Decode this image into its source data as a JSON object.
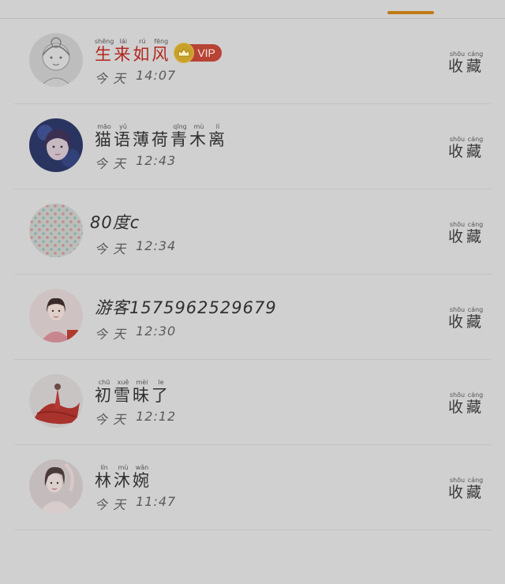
{
  "users": [
    {
      "name_chars": [
        "生",
        "来",
        "如",
        "风"
      ],
      "name_pinyin": [
        "shēng",
        "lái",
        "rú",
        "fēng"
      ],
      "day": "今 天",
      "time": "14:07",
      "vip": true,
      "vip_label": "VIP",
      "avatar": "sketch-girl-avatar"
    },
    {
      "name_chars": [
        "猫",
        "语",
        "薄",
        "荷",
        "青",
        "木",
        "离"
      ],
      "name_pinyin": [
        "māo",
        "yǔ",
        "",
        "",
        "qīng",
        "mù",
        "lí"
      ],
      "day": "今 天",
      "time": "12:43",
      "vip": false,
      "avatar": "blue-haired-girl-avatar"
    },
    {
      "name_text": "80度c",
      "day": "今 天",
      "time": "12:34",
      "vip": false,
      "avatar": "polka-dot-pattern-avatar"
    },
    {
      "name_text": "游客1575962529679",
      "day": "今 天",
      "time": "12:30",
      "vip": false,
      "avatar": "pink-dress-girl-avatar"
    },
    {
      "name_chars": [
        "初",
        "雪",
        "昧",
        "了"
      ],
      "name_pinyin": [
        "chū",
        "xuě",
        "mèi",
        "le"
      ],
      "day": "今 天",
      "time": "12:12",
      "vip": false,
      "avatar": "red-gown-figure-avatar"
    },
    {
      "name_chars": [
        "林",
        "沐",
        "婉"
      ],
      "name_pinyin": [
        "lín",
        "mù",
        "wǎn"
      ],
      "day": "今 天",
      "time": "11:47",
      "vip": false,
      "avatar": "ancient-costume-girl-avatar"
    }
  ],
  "collect": {
    "chars": [
      "收",
      "藏"
    ],
    "pinyin": [
      "shōu",
      "cáng"
    ]
  },
  "colors": {
    "accent": "#c07a12",
    "vip_name": "#b3261e",
    "vip_badge": "#b74334",
    "background": "#d0d0d0"
  }
}
